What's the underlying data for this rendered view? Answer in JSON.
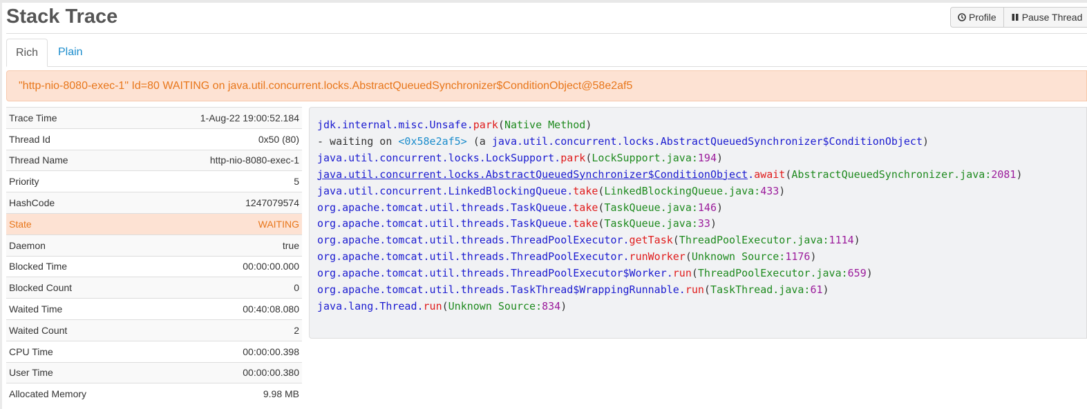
{
  "page": {
    "title": "Stack Trace"
  },
  "toolbar": {
    "profile_label": "Profile",
    "pause_label": "Pause Thread"
  },
  "tabs": [
    {
      "label": "Rich",
      "active": true
    },
    {
      "label": "Plain",
      "active": false
    }
  ],
  "alert": {
    "text": "\"http-nio-8080-exec-1\" Id=80 WAITING on java.util.concurrent.locks.AbstractQueuedSynchronizer$ConditionObject@58e2af5"
  },
  "properties": [
    {
      "label": "Trace Time",
      "value": "1-Aug-22 19:00:52.184"
    },
    {
      "label": "Thread Id",
      "value": "0x50 (80)"
    },
    {
      "label": "Thread Name",
      "value": "http-nio-8080-exec-1"
    },
    {
      "label": "Priority",
      "value": "5"
    },
    {
      "label": "HashCode",
      "value": "1247079574"
    },
    {
      "label": "State",
      "value": "WAITING"
    },
    {
      "label": "Daemon",
      "value": "true"
    },
    {
      "label": "Blocked Time",
      "value": "00:00:00.000"
    },
    {
      "label": "Blocked Count",
      "value": "0"
    },
    {
      "label": "Waited Time",
      "value": "00:40:08.080"
    },
    {
      "label": "Waited Count",
      "value": "2"
    },
    {
      "label": "CPU Time",
      "value": "00:00:00.398"
    },
    {
      "label": "User Time",
      "value": "00:00:00.380"
    },
    {
      "label": "Allocated Memory",
      "value": "9.98 MB"
    }
  ],
  "trace": {
    "line0": {
      "cls": "jdk.internal.misc.Unsafe",
      "method": "park",
      "source": "Native Method"
    },
    "wait": {
      "prefix": "- waiting on",
      "lock": "<0x58e2af5>",
      "a": "(a",
      "cls": "java.util.concurrent.locks.AbstractQueuedSynchronizer$ConditionObject"
    },
    "frames": [
      {
        "cls": "java.util.concurrent.locks.LockSupport",
        "method": "park",
        "file": "LockSupport.java",
        "line": "194"
      },
      {
        "cls": "java.util.concurrent.locks.AbstractQueuedSynchronizer$ConditionObject",
        "method": "await",
        "file": "AbstractQueuedSynchronizer.java",
        "line": "2081"
      },
      {
        "cls": "java.util.concurrent.LinkedBlockingQueue",
        "method": "take",
        "file": "LinkedBlockingQueue.java",
        "line": "433"
      },
      {
        "cls": "org.apache.tomcat.util.threads.TaskQueue",
        "method": "take",
        "file": "TaskQueue.java",
        "line": "146"
      },
      {
        "cls": "org.apache.tomcat.util.threads.TaskQueue",
        "method": "take",
        "file": "TaskQueue.java",
        "line": "33"
      },
      {
        "cls": "org.apache.tomcat.util.threads.ThreadPoolExecutor",
        "method": "getTask",
        "file": "ThreadPoolExecutor.java",
        "line": "1114"
      },
      {
        "cls": "org.apache.tomcat.util.threads.ThreadPoolExecutor",
        "method": "runWorker",
        "file": "Unknown Source",
        "line": "1176"
      },
      {
        "cls": "org.apache.tomcat.util.threads.ThreadPoolExecutor$Worker",
        "method": "run",
        "file": "ThreadPoolExecutor.java",
        "line": "659"
      },
      {
        "cls": "org.apache.tomcat.util.threads.TaskThread$WrappingRunnable",
        "method": "run",
        "file": "TaskThread.java",
        "line": "61"
      },
      {
        "cls": "java.lang.Thread",
        "method": "run",
        "file": "Unknown Source",
        "line": "834"
      }
    ]
  },
  "colors": {
    "accent": "#1a8ccc",
    "warning_bg": "#fde2d3",
    "warning_text": "#e8761a"
  },
  "icons": {
    "profile": "clock-icon",
    "pause": "pause-icon"
  }
}
